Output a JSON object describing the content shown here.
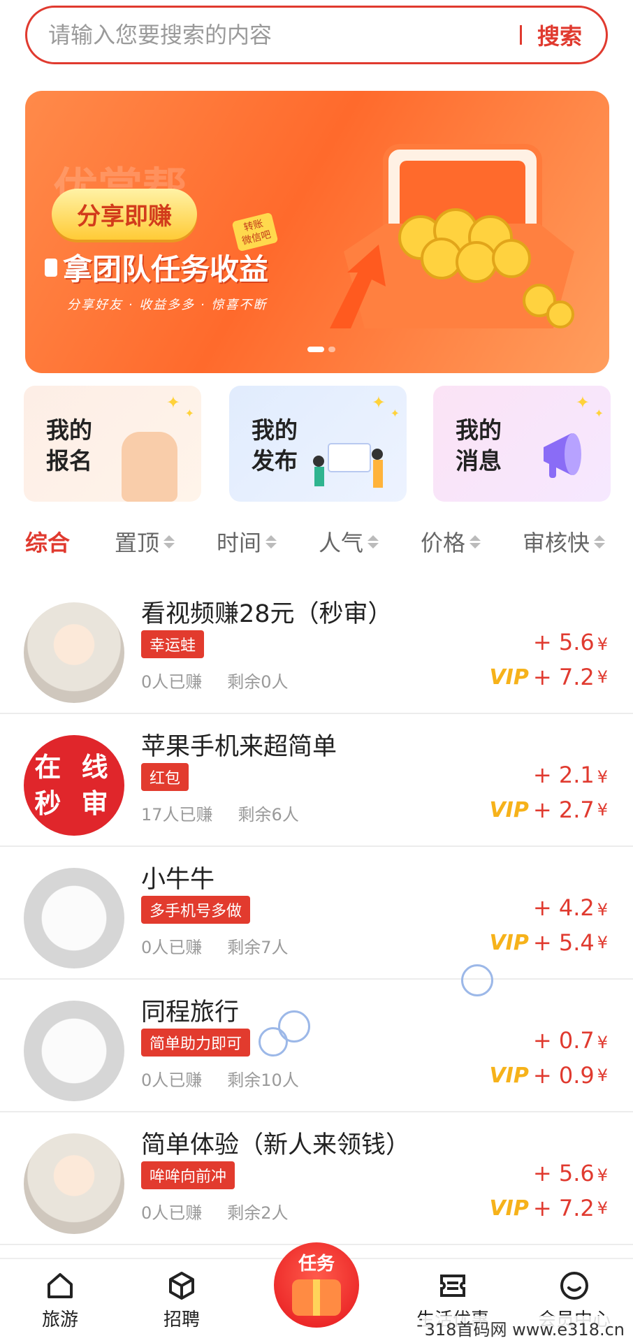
{
  "search": {
    "placeholder": "请输入您要搜索的内容",
    "button": "搜索"
  },
  "banner": {
    "brand": "优赏帮",
    "pill": "分享即赚",
    "tag": "转账\n微信吧",
    "headline": "拿团队任务收益",
    "subline": "分享好友 · 收益多多 · 惊喜不断"
  },
  "quick_cards": [
    {
      "label": "我的\n报名"
    },
    {
      "label": "我的\n发布"
    },
    {
      "label": "我的\n消息"
    }
  ],
  "filter_tabs": [
    {
      "label": "综合"
    },
    {
      "label": "置顶"
    },
    {
      "label": "时间"
    },
    {
      "label": "人气"
    },
    {
      "label": "价格"
    },
    {
      "label": "审核快"
    }
  ],
  "tasks": [
    {
      "title": "看视频赚28元（秒审）",
      "tag": "幸运蛙",
      "earned": "0人已赚",
      "remain": "剩余0人",
      "price": "+ 5.6",
      "vip_price": "+ 7.2"
    },
    {
      "title": "苹果手机来超简单",
      "tag": "红包",
      "earned": "17人已赚",
      "remain": "剩余6人",
      "price": "+ 2.1",
      "vip_price": "+ 2.7",
      "avatar_text_1": "在 线",
      "avatar_text_2": "秒 审"
    },
    {
      "title": "小牛牛",
      "tag": "多手机号多做",
      "earned": "0人已赚",
      "remain": "剩余7人",
      "price": "+ 4.2",
      "vip_price": "+ 5.4"
    },
    {
      "title": "同程旅行",
      "tag": "简单助力即可",
      "earned": "0人已赚",
      "remain": "剩余10人",
      "price": "+ 0.7",
      "vip_price": "+ 0.9"
    },
    {
      "title": "简单体验（新人来领钱）",
      "tag": "哞哞向前冲",
      "earned": "0人已赚",
      "remain": "剩余2人",
      "price": "+ 5.6",
      "vip_price": "+ 7.2"
    }
  ],
  "currency": "¥",
  "vip_label": "VIP",
  "bottom_nav": {
    "items": [
      {
        "label": "旅游",
        "icon": "home-icon"
      },
      {
        "label": "招聘",
        "icon": "cube-icon"
      },
      {
        "label": "生活优惠",
        "icon": "ticket-icon"
      },
      {
        "label": "会员中心",
        "icon": "smile-icon"
      }
    ],
    "center_label": "任务"
  },
  "watermark": "318首码网 www.e318.cn",
  "colors": {
    "accent": "#e03a2f",
    "vip": "#f6b21a"
  }
}
